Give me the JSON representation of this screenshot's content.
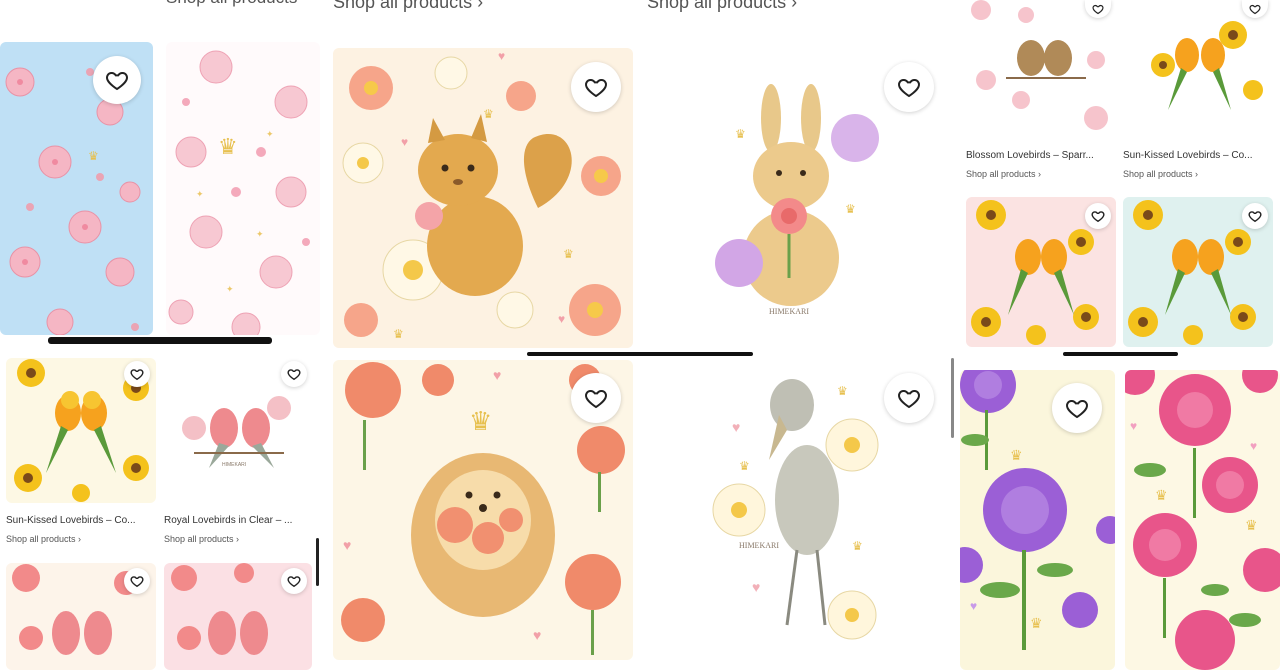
{
  "shop_link": "Shop all products",
  "chevron": "›",
  "watermark": "HIMEKARI",
  "products": {
    "blossom_lovebirds": {
      "title": "Blossom Lovebirds – Sparr...",
      "shop": "Shop all products ›"
    },
    "sunkissed_right": {
      "title": "Sun-Kissed Lovebirds – Co...",
      "shop": "Shop all products ›"
    },
    "sunkissed_left": {
      "title": "Sun-Kissed Lovebirds – Co...",
      "shop": "Shop all products ›"
    },
    "royal_lovebirds": {
      "title": "Royal Lovebirds in Clear – ...",
      "shop": "Shop all products ›"
    }
  },
  "icons": [
    "heart-icon",
    "chevron-right-icon",
    "scrollbar"
  ],
  "colors": {
    "sky_blue": "#bfe0f5",
    "cream": "#fdf6e3",
    "pink": "#f7d9dc",
    "yellow": "#f6c92a",
    "purple": "#9b5fd6",
    "rose": "#e8558a"
  }
}
